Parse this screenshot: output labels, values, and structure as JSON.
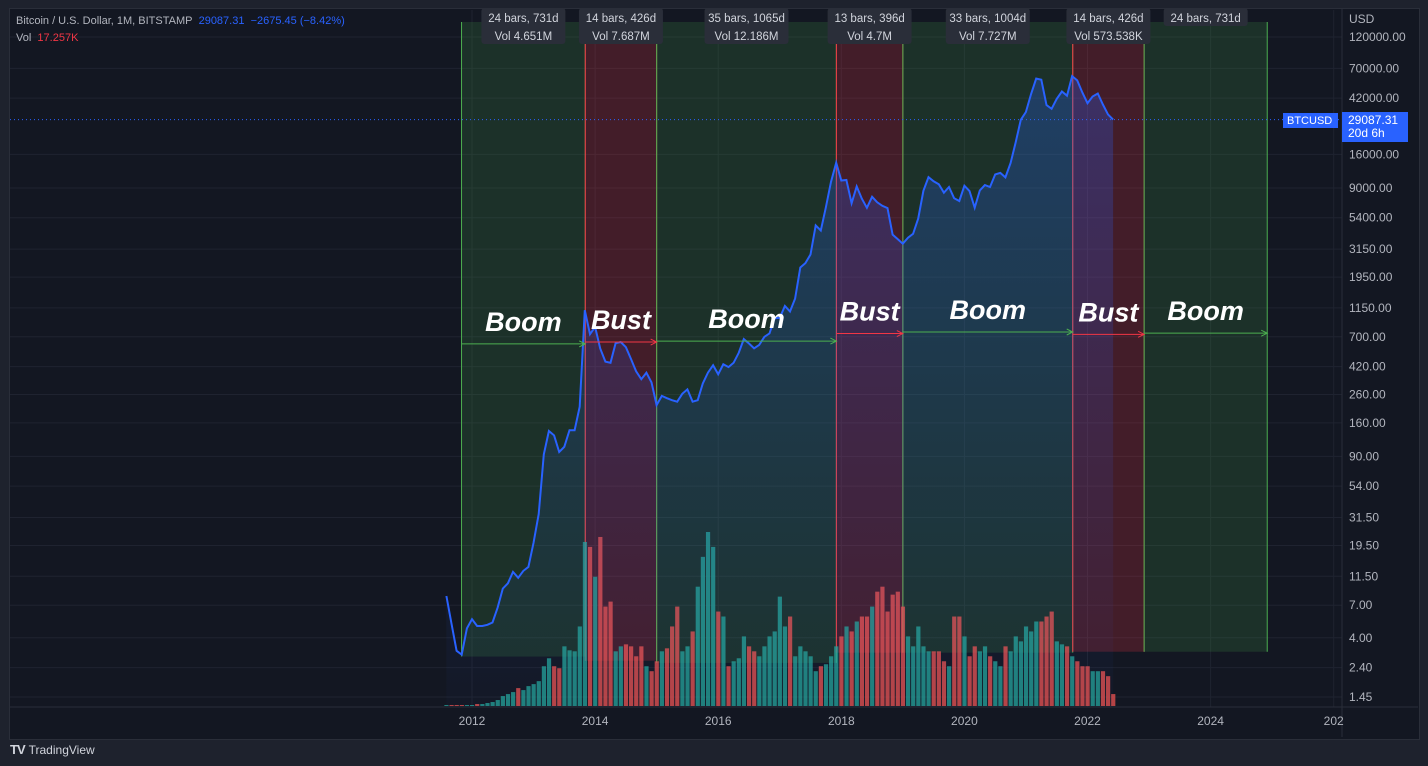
{
  "legend": {
    "symbol": "Bitcoin / U.S. Dollar, 1M, BITSTAMP",
    "price": "29087.31",
    "change": "−2675.45 (−8.42%)",
    "vol_label": "Vol",
    "vol_value": "17.257K"
  },
  "price_axis": {
    "currency": "USD",
    "badge_symbol": "BTCUSD",
    "badge_price": "29087.31",
    "badge_countdown": "20d 6h"
  },
  "brand": {
    "name": "TradingView",
    "logo": "TV"
  },
  "colors": {
    "line": "#2962ff",
    "up": "#26a69a",
    "down": "#ef5350",
    "boom": "#4caf50",
    "bust": "#f23645"
  },
  "chart_data": {
    "type": "line",
    "title": "Bitcoin / U.S. Dollar, 1M, BITSTAMP",
    "scale": "log",
    "ylim": [
      1.45,
      155000
    ],
    "xlim": [
      2011.0,
      2025.8
    ],
    "y_ticks": [
      "120000.00",
      "70000.00",
      "42000.00",
      "16000.00",
      "9000.00",
      "5400.00",
      "3150.00",
      "1950.00",
      "1150.00",
      "700.00",
      "420.00",
      "260.00",
      "160.00",
      "90.00",
      "54.00",
      "31.50",
      "19.50",
      "11.50",
      "7.00",
      "4.00",
      "2.40",
      "1.45"
    ],
    "x_ticks": [
      "2012",
      "2014",
      "2016",
      "2018",
      "2020",
      "2022",
      "2024",
      "202"
    ],
    "start": [
      2011,
      8
    ],
    "close": [
      8.2,
      5.1,
      3.2,
      3.0,
      4.7,
      5.5,
      4.9,
      4.9,
      5.0,
      5.2,
      6.7,
      9.3,
      10.2,
      12.4,
      11.2,
      12.6,
      13.5,
      20.4,
      33.4,
      93,
      139,
      129,
      97,
      106,
      141,
      141,
      211,
      1105,
      732,
      829,
      573,
      457,
      448,
      627,
      640,
      586,
      478,
      387,
      338,
      378,
      320,
      217,
      254,
      244,
      236,
      230,
      263,
      284,
      230,
      236,
      314,
      378,
      430,
      368,
      437,
      416,
      448,
      531,
      673,
      624,
      575,
      609,
      700,
      742,
      963,
      970,
      1190,
      1080,
      1348,
      2300,
      2480,
      2875,
      4735,
      4338,
      6468,
      10000,
      13880,
      10220,
      10320,
      6930,
      9240,
      7500,
      6400,
      7730,
      7030,
      6630,
      6370,
      4040,
      3740,
      3460,
      3830,
      4100,
      5320,
      8570,
      10820,
      10080,
      9600,
      8300,
      9150,
      7550,
      7190,
      9350,
      8540,
      6410,
      8620,
      9450,
      9140,
      11350,
      11660,
      10780,
      13800,
      19700,
      28990,
      33100,
      45200,
      58800,
      57700,
      37300,
      35000,
      41500,
      47100,
      43800,
      61300,
      57000,
      46200,
      38500,
      43200,
      45500,
      37700,
      31800,
      29087
    ],
    "volume": [
      1,
      1,
      1,
      1,
      1,
      1,
      2,
      2,
      3,
      4,
      6,
      10,
      12,
      14,
      18,
      16,
      20,
      22,
      25,
      40,
      48,
      40,
      38,
      60,
      56,
      55,
      80,
      165,
      160,
      130,
      170,
      100,
      105,
      55,
      60,
      62,
      60,
      50,
      60,
      40,
      35,
      45,
      55,
      58,
      80,
      100,
      55,
      60,
      75,
      120,
      150,
      175,
      160,
      95,
      90,
      40,
      45,
      48,
      70,
      60,
      55,
      50,
      60,
      70,
      75,
      110,
      80,
      90,
      50,
      60,
      55,
      50,
      35,
      40,
      42,
      50,
      60,
      70,
      80,
      75,
      85,
      90,
      90,
      100,
      115,
      120,
      95,
      112,
      115,
      100,
      70,
      60,
      80,
      60,
      55,
      55,
      55,
      45,
      40,
      90,
      90,
      70,
      50,
      60,
      55,
      60,
      50,
      45,
      40,
      60,
      55,
      70,
      65,
      80,
      75,
      85,
      85,
      90,
      95,
      65,
      62,
      60,
      50,
      45,
      40,
      40,
      35,
      35,
      35,
      30,
      12
    ],
    "last_price": 29087.31,
    "cycles": [
      {
        "type": "boom",
        "label": "Boom",
        "from": 2011.83,
        "to": 2013.84,
        "low": 2.9,
        "arrow_at": 620,
        "bars": "24 bars, 731d",
        "vol": "Vol 4.651M"
      },
      {
        "type": "bust",
        "label": "Bust",
        "from": 2013.84,
        "to": 2015.0,
        "low": 2.7,
        "arrow_at": 640,
        "bars": "14 bars, 426d",
        "vol": "Vol 7.687M"
      },
      {
        "type": "boom",
        "label": "Boom",
        "from": 2015.0,
        "to": 2017.92,
        "low": 2.6,
        "arrow_at": 650,
        "bars": "35 bars, 1065d",
        "vol": "Vol 12.186M"
      },
      {
        "type": "bust",
        "label": "Bust",
        "from": 2017.92,
        "to": 2019.0,
        "low": 3.1,
        "arrow_at": 740,
        "bars": "13 bars, 396d",
        "vol": "Vol 4.7M"
      },
      {
        "type": "boom",
        "label": "Boom",
        "from": 2019.0,
        "to": 2021.76,
        "low": 3.1,
        "arrow_at": 760,
        "bars": "33 bars, 1004d",
        "vol": "Vol 7.727M"
      },
      {
        "type": "bust",
        "label": "Bust",
        "from": 2021.76,
        "to": 2022.92,
        "low": 3.15,
        "arrow_at": 730,
        "bars": "14 bars, 426d",
        "vol": "Vol 573.538K"
      },
      {
        "type": "boom",
        "label": "Boom",
        "from": 2022.92,
        "to": 2024.92,
        "low": 3.15,
        "arrow_at": 745,
        "bars": "24 bars, 731d",
        "vol": ""
      }
    ]
  }
}
